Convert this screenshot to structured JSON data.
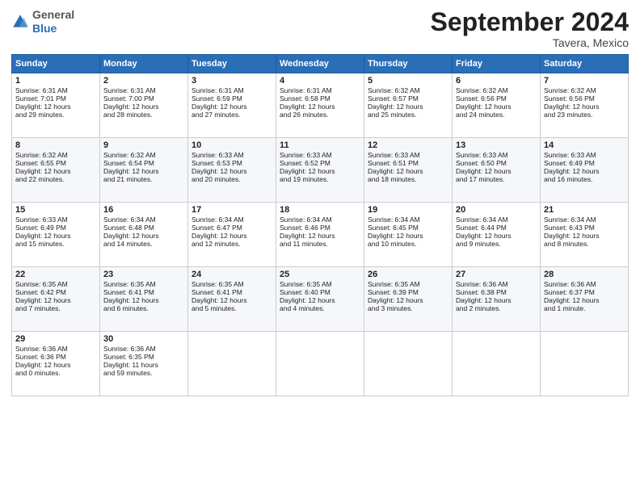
{
  "header": {
    "logo_general": "General",
    "logo_blue": "Blue",
    "month_title": "September 2024",
    "location": "Tavera, Mexico"
  },
  "days_of_week": [
    "Sunday",
    "Monday",
    "Tuesday",
    "Wednesday",
    "Thursday",
    "Friday",
    "Saturday"
  ],
  "weeks": [
    [
      {
        "day": 1,
        "lines": [
          "Sunrise: 6:31 AM",
          "Sunset: 7:01 PM",
          "Daylight: 12 hours",
          "and 29 minutes."
        ]
      },
      {
        "day": 2,
        "lines": [
          "Sunrise: 6:31 AM",
          "Sunset: 7:00 PM",
          "Daylight: 12 hours",
          "and 28 minutes."
        ]
      },
      {
        "day": 3,
        "lines": [
          "Sunrise: 6:31 AM",
          "Sunset: 6:59 PM",
          "Daylight: 12 hours",
          "and 27 minutes."
        ]
      },
      {
        "day": 4,
        "lines": [
          "Sunrise: 6:31 AM",
          "Sunset: 6:58 PM",
          "Daylight: 12 hours",
          "and 26 minutes."
        ]
      },
      {
        "day": 5,
        "lines": [
          "Sunrise: 6:32 AM",
          "Sunset: 6:57 PM",
          "Daylight: 12 hours",
          "and 25 minutes."
        ]
      },
      {
        "day": 6,
        "lines": [
          "Sunrise: 6:32 AM",
          "Sunset: 6:56 PM",
          "Daylight: 12 hours",
          "and 24 minutes."
        ]
      },
      {
        "day": 7,
        "lines": [
          "Sunrise: 6:32 AM",
          "Sunset: 6:56 PM",
          "Daylight: 12 hours",
          "and 23 minutes."
        ]
      }
    ],
    [
      {
        "day": 8,
        "lines": [
          "Sunrise: 6:32 AM",
          "Sunset: 6:55 PM",
          "Daylight: 12 hours",
          "and 22 minutes."
        ]
      },
      {
        "day": 9,
        "lines": [
          "Sunrise: 6:32 AM",
          "Sunset: 6:54 PM",
          "Daylight: 12 hours",
          "and 21 minutes."
        ]
      },
      {
        "day": 10,
        "lines": [
          "Sunrise: 6:33 AM",
          "Sunset: 6:53 PM",
          "Daylight: 12 hours",
          "and 20 minutes."
        ]
      },
      {
        "day": 11,
        "lines": [
          "Sunrise: 6:33 AM",
          "Sunset: 6:52 PM",
          "Daylight: 12 hours",
          "and 19 minutes."
        ]
      },
      {
        "day": 12,
        "lines": [
          "Sunrise: 6:33 AM",
          "Sunset: 6:51 PM",
          "Daylight: 12 hours",
          "and 18 minutes."
        ]
      },
      {
        "day": 13,
        "lines": [
          "Sunrise: 6:33 AM",
          "Sunset: 6:50 PM",
          "Daylight: 12 hours",
          "and 17 minutes."
        ]
      },
      {
        "day": 14,
        "lines": [
          "Sunrise: 6:33 AM",
          "Sunset: 6:49 PM",
          "Daylight: 12 hours",
          "and 16 minutes."
        ]
      }
    ],
    [
      {
        "day": 15,
        "lines": [
          "Sunrise: 6:33 AM",
          "Sunset: 6:49 PM",
          "Daylight: 12 hours",
          "and 15 minutes."
        ]
      },
      {
        "day": 16,
        "lines": [
          "Sunrise: 6:34 AM",
          "Sunset: 6:48 PM",
          "Daylight: 12 hours",
          "and 14 minutes."
        ]
      },
      {
        "day": 17,
        "lines": [
          "Sunrise: 6:34 AM",
          "Sunset: 6:47 PM",
          "Daylight: 12 hours",
          "and 12 minutes."
        ]
      },
      {
        "day": 18,
        "lines": [
          "Sunrise: 6:34 AM",
          "Sunset: 6:46 PM",
          "Daylight: 12 hours",
          "and 11 minutes."
        ]
      },
      {
        "day": 19,
        "lines": [
          "Sunrise: 6:34 AM",
          "Sunset: 6:45 PM",
          "Daylight: 12 hours",
          "and 10 minutes."
        ]
      },
      {
        "day": 20,
        "lines": [
          "Sunrise: 6:34 AM",
          "Sunset: 6:44 PM",
          "Daylight: 12 hours",
          "and 9 minutes."
        ]
      },
      {
        "day": 21,
        "lines": [
          "Sunrise: 6:34 AM",
          "Sunset: 6:43 PM",
          "Daylight: 12 hours",
          "and 8 minutes."
        ]
      }
    ],
    [
      {
        "day": 22,
        "lines": [
          "Sunrise: 6:35 AM",
          "Sunset: 6:42 PM",
          "Daylight: 12 hours",
          "and 7 minutes."
        ]
      },
      {
        "day": 23,
        "lines": [
          "Sunrise: 6:35 AM",
          "Sunset: 6:41 PM",
          "Daylight: 12 hours",
          "and 6 minutes."
        ]
      },
      {
        "day": 24,
        "lines": [
          "Sunrise: 6:35 AM",
          "Sunset: 6:41 PM",
          "Daylight: 12 hours",
          "and 5 minutes."
        ]
      },
      {
        "day": 25,
        "lines": [
          "Sunrise: 6:35 AM",
          "Sunset: 6:40 PM",
          "Daylight: 12 hours",
          "and 4 minutes."
        ]
      },
      {
        "day": 26,
        "lines": [
          "Sunrise: 6:35 AM",
          "Sunset: 6:39 PM",
          "Daylight: 12 hours",
          "and 3 minutes."
        ]
      },
      {
        "day": 27,
        "lines": [
          "Sunrise: 6:36 AM",
          "Sunset: 6:38 PM",
          "Daylight: 12 hours",
          "and 2 minutes."
        ]
      },
      {
        "day": 28,
        "lines": [
          "Sunrise: 6:36 AM",
          "Sunset: 6:37 PM",
          "Daylight: 12 hours",
          "and 1 minute."
        ]
      }
    ],
    [
      {
        "day": 29,
        "lines": [
          "Sunrise: 6:36 AM",
          "Sunset: 6:36 PM",
          "Daylight: 12 hours",
          "and 0 minutes."
        ]
      },
      {
        "day": 30,
        "lines": [
          "Sunrise: 6:36 AM",
          "Sunset: 6:35 PM",
          "Daylight: 11 hours",
          "and 59 minutes."
        ]
      },
      null,
      null,
      null,
      null,
      null
    ]
  ]
}
